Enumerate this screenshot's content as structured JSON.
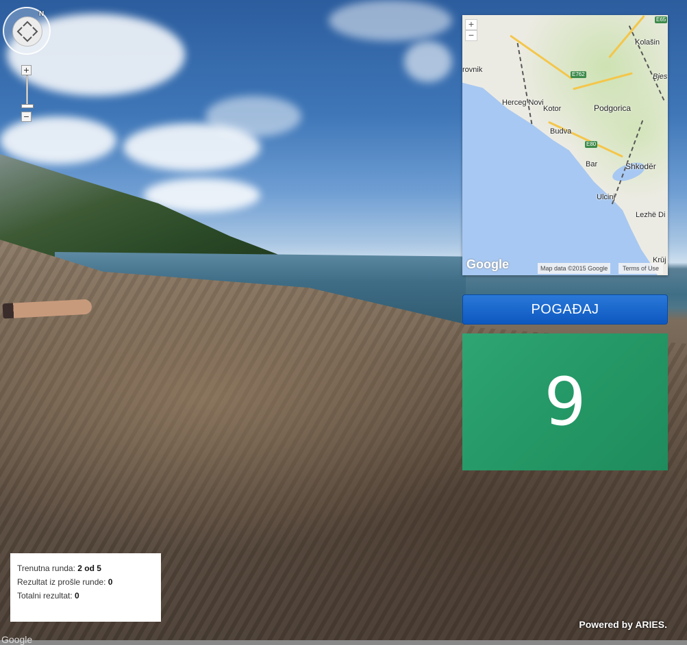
{
  "street_view": {
    "north_label": "N",
    "zoom_in": "+",
    "zoom_out": "−",
    "google_mark": "Google"
  },
  "minimap": {
    "zoom_in": "+",
    "zoom_out": "−",
    "labels": {
      "dubrovnik": "rovnik",
      "herceg_novi": "Herceg Novi",
      "kotor": "Kotor",
      "podgorica": "Podgorica",
      "budva": "Budva",
      "bar": "Bar",
      "shkoder": "Shkodër",
      "ulcinj": "Ulcinj",
      "lezhe": "Lezhë Di",
      "kolasin": "Kolašin",
      "bijelo": "Bjes",
      "kruj": "Krūj"
    },
    "shields": [
      "E65",
      "E762",
      "E80"
    ],
    "google_logo": "Google",
    "map_data": "Map data ©2015 Google",
    "terms": "Terms of Use"
  },
  "guess_button": {
    "label": "POGAĐAJ"
  },
  "timer": {
    "value": "9"
  },
  "score_panel": {
    "round_label": "Trenutna runda:",
    "round_value": "2 od 5",
    "last_label": "Rezultat iz prošle runde:",
    "last_value": "0",
    "total_label": "Totalni rezultat:",
    "total_value": "0"
  },
  "footer": {
    "powered_by": "Powered by ARIES."
  },
  "colors": {
    "guess_button": "#1565d0",
    "timer_bg": "#27996a",
    "score_bg": "#ffffff"
  }
}
